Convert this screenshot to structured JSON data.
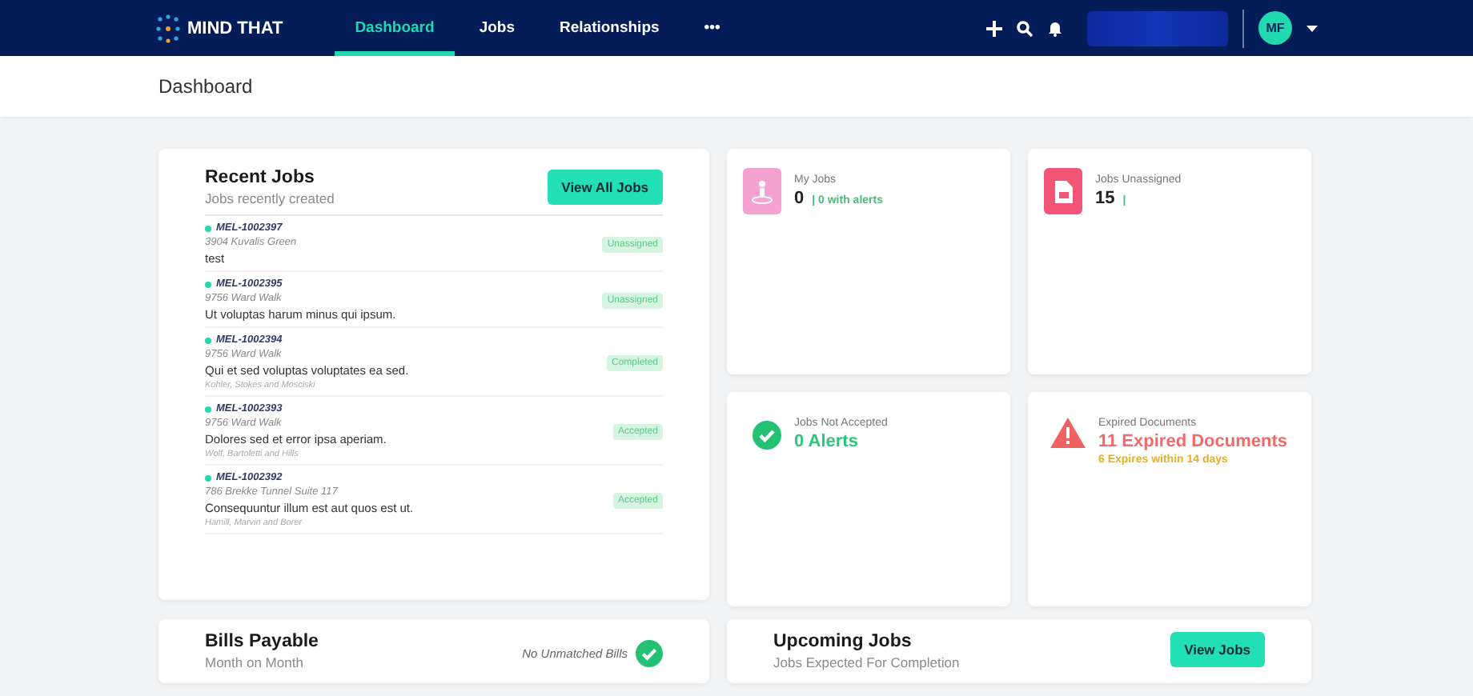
{
  "nav": {
    "logo": "MIND THAT",
    "tabs": [
      {
        "label": "Dashboard",
        "selected": true
      },
      {
        "label": "Jobs",
        "selected": false
      },
      {
        "label": "Relationships",
        "selected": false
      },
      {
        "label": "•••",
        "selected": false
      }
    ],
    "avatar": "MF"
  },
  "page_title": "Dashboard",
  "recent_jobs": {
    "title": "Recent Jobs",
    "subtitle": "Jobs recently created",
    "button": "View All Jobs",
    "items": [
      {
        "id": "MEL-1002397",
        "address": "3904 Kuvalis Green",
        "description": "test",
        "status": "Unassigned"
      },
      {
        "id": "MEL-1002395",
        "address": "9756 Ward Walk",
        "description": "Ut voluptas harum minus qui ipsum.",
        "status": "Unassigned"
      },
      {
        "id": "MEL-1002394",
        "address": "9756 Ward Walk",
        "description": "Qui et sed voluptas voluptates ea sed.",
        "company": "Kohler, Stokes and Mosciski",
        "status": "Completed"
      },
      {
        "id": "MEL-1002393",
        "address": "9756 Ward Walk",
        "description": "Dolores sed et error ipsa aperiam.",
        "company": "Wolf, Bartoletti and Hills",
        "status": "Accepted"
      },
      {
        "id": "MEL-1002392",
        "address": "786 Brekke Tunnel Suite 117",
        "description": "Consequuntur illum est aut quos est ut.",
        "company": "Hamill, Marvin and Borer",
        "status": "Accepted"
      }
    ]
  },
  "stats": [
    {
      "kind": "my_jobs",
      "label": "My Jobs",
      "value": "0",
      "note": "| 0 with alerts"
    },
    {
      "kind": "unassigned",
      "label": "Jobs Unassigned",
      "value": "15",
      "note": "|"
    },
    {
      "kind": "not_accepted",
      "label": "Jobs Not Accepted",
      "value": "0 Alerts"
    },
    {
      "kind": "expired",
      "label": "Expired Documents",
      "value": "11 Expired Documents",
      "note": "6 Expires within 14 days"
    }
  ],
  "bills": {
    "title": "Bills Payable",
    "subtitle": "Month on Month",
    "status": "No Unmatched Bills"
  },
  "upcoming": {
    "title": "Upcoming Jobs",
    "subtitle": "Jobs Expected For Completion",
    "button": "View Jobs"
  }
}
